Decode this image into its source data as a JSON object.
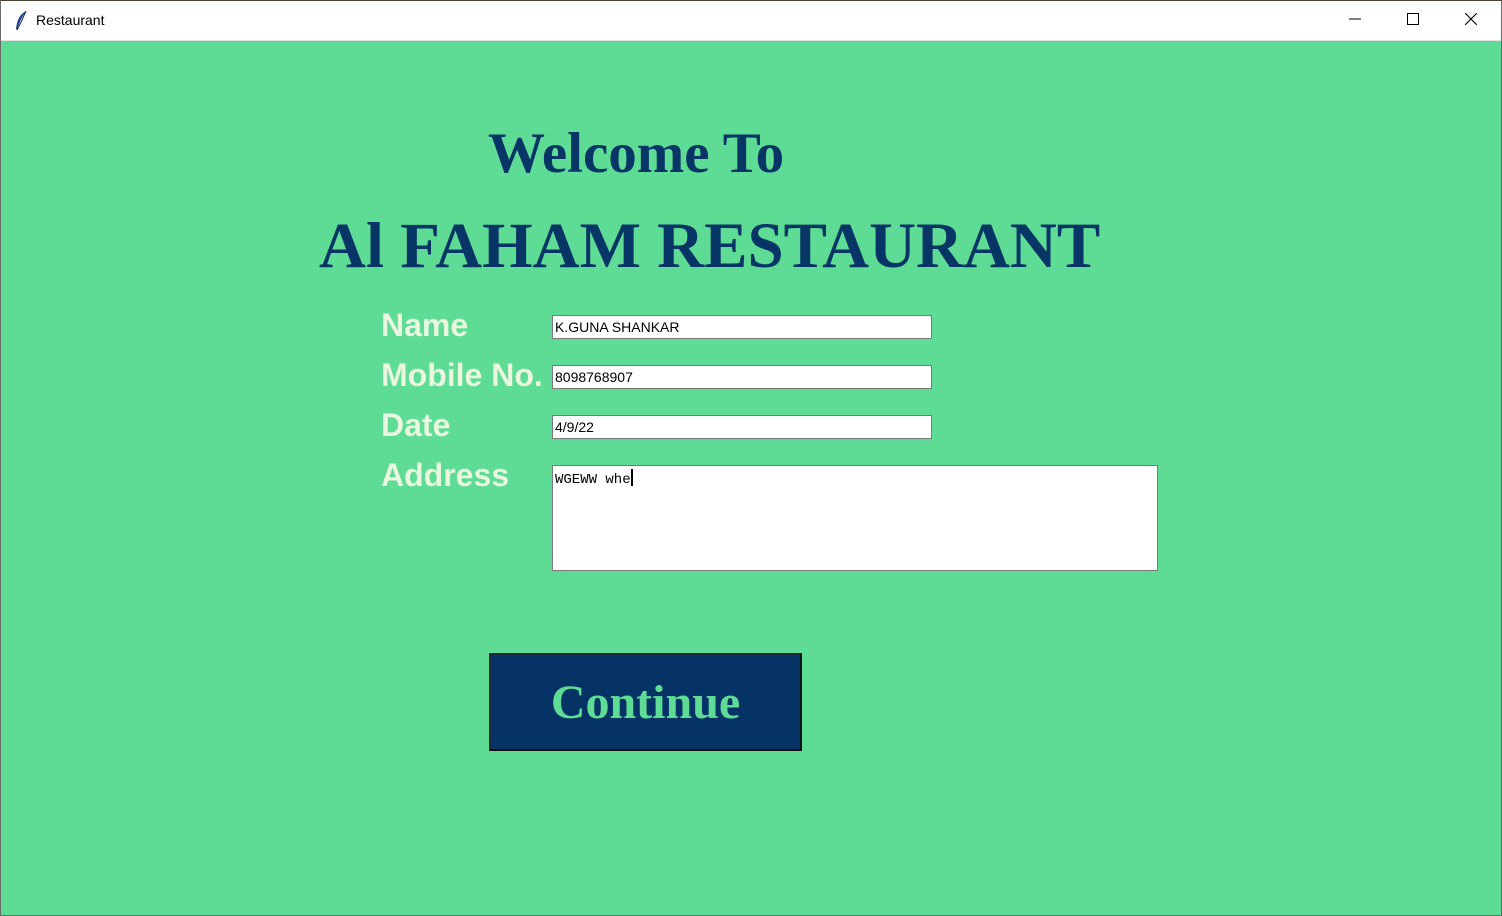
{
  "window": {
    "title": "Restaurant"
  },
  "header": {
    "welcome": "Welcome To",
    "restaurant_name": "Al FAHAM RESTAURANT"
  },
  "form": {
    "name_label": "Name",
    "name_value": "K.GUNA SHANKAR",
    "mobile_label": "Mobile No.",
    "mobile_value": "8098768907",
    "date_label": "Date",
    "date_value": "4/9/22",
    "address_label": "Address",
    "address_value": "WGEWW whe"
  },
  "actions": {
    "continue_label": "Continue"
  },
  "colors": {
    "background": "#5edc96",
    "heading": "#073566",
    "label": "#eaf6de",
    "button_bg": "#063366",
    "button_text": "#5edc96"
  },
  "icons": {
    "app": "feather-icon",
    "minimize": "minimize-icon",
    "maximize": "maximize-icon",
    "close": "close-icon"
  }
}
